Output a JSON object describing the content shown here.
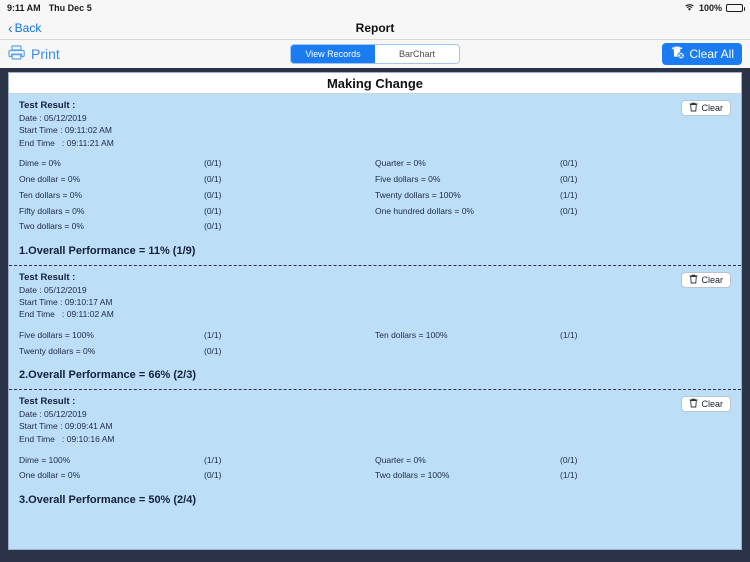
{
  "statusbar": {
    "time": "9:11 AM",
    "date": "Thu Dec 5",
    "wifi_icon": "wifi-icon",
    "battery_percent": "100%",
    "battery_icon": "battery-icon"
  },
  "navbar": {
    "back_label": "Back",
    "back_icon": "chevron-left-icon",
    "title": "Report"
  },
  "toolbar": {
    "print_label": "Print",
    "print_icon": "printer-icon",
    "segments": [
      {
        "label": "View Records",
        "active": true
      },
      {
        "label": "BarChart",
        "active": false
      }
    ],
    "clear_all_label": "Clear All",
    "clear_all_icon": "trash-x-icon",
    "accent_color": "#1a7cf0"
  },
  "page": {
    "title": "Making Change",
    "card_color": "#bcdef7",
    "frame_color": "#2b3349"
  },
  "clear_button": {
    "label": "Clear",
    "icon": "trash-icon"
  },
  "records": [
    {
      "heading": "Test Result :",
      "date": "Date : 05/12/2019",
      "start_time": "Start Time : 09:11:02 AM",
      "end_time": "End Time   : 09:11:21 AM",
      "rows": [
        {
          "left_label": "Dime = 0%",
          "left_frac": "(0/1)",
          "right_label": "Quarter = 0%",
          "right_frac": "(0/1)"
        },
        {
          "left_label": "One dollar = 0%",
          "left_frac": "(0/1)",
          "right_label": "Five dollars = 0%",
          "right_frac": "(0/1)"
        },
        {
          "left_label": "Ten dollars = 0%",
          "left_frac": "(0/1)",
          "right_label": "Twenty dollars = 100%",
          "right_frac": "(1/1)"
        },
        {
          "left_label": "Fifty dollars = 0%",
          "left_frac": "(0/1)",
          "right_label": "One hundred dollars = 0%",
          "right_frac": "(0/1)"
        },
        {
          "left_label": "Two dollars = 0%",
          "left_frac": "(0/1)",
          "right_label": "",
          "right_frac": ""
        }
      ],
      "overall": "1.Overall Performance = 11% (1/9)"
    },
    {
      "heading": "Test Result :",
      "date": "Date : 05/12/2019",
      "start_time": "Start Time : 09:10:17 AM",
      "end_time": "End Time   : 09:11:02 AM",
      "rows": [
        {
          "left_label": "Five dollars = 100%",
          "left_frac": "(1/1)",
          "right_label": "Ten dollars = 100%",
          "right_frac": "(1/1)"
        },
        {
          "left_label": "Twenty dollars = 0%",
          "left_frac": "(0/1)",
          "right_label": "",
          "right_frac": ""
        }
      ],
      "overall": "2.Overall Performance = 66% (2/3)"
    },
    {
      "heading": "Test Result :",
      "date": "Date : 05/12/2019",
      "start_time": "Start Time : 09:09:41 AM",
      "end_time": "End Time   : 09:10:16 AM",
      "rows": [
        {
          "left_label": "Dime = 100%",
          "left_frac": "(1/1)",
          "right_label": "Quarter = 0%",
          "right_frac": "(0/1)"
        },
        {
          "left_label": "One dollar = 0%",
          "left_frac": "(0/1)",
          "right_label": "Two dollars = 100%",
          "right_frac": "(1/1)"
        }
      ],
      "overall": "3.Overall Performance = 50% (2/4)"
    }
  ]
}
